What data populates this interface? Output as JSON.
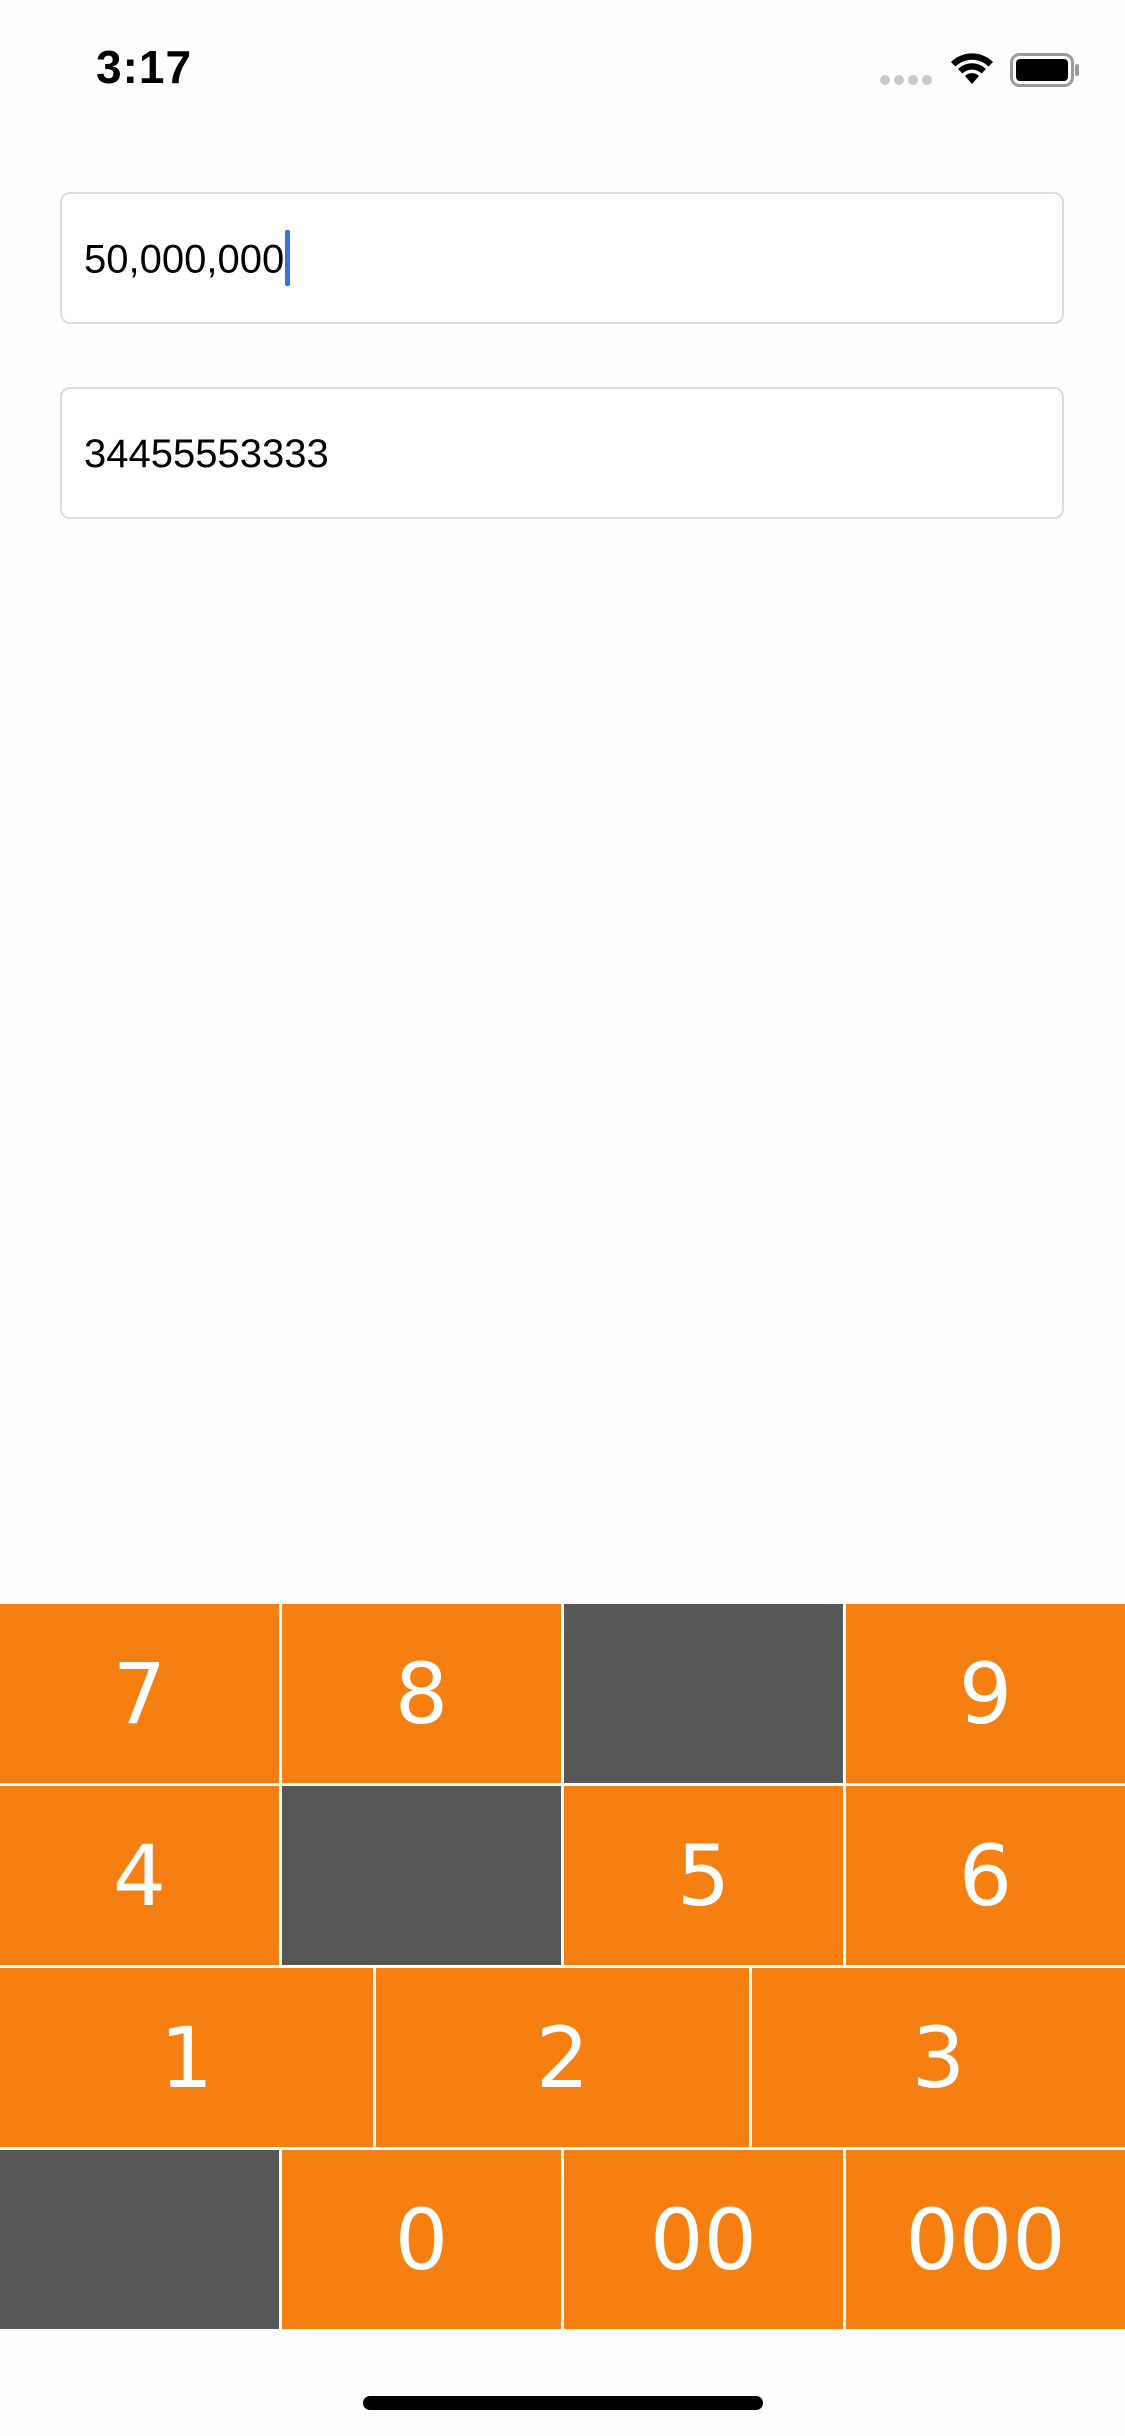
{
  "status_bar": {
    "time": "3:17"
  },
  "fields": {
    "amount_value": "50,000,000",
    "phone_value": "34455553333"
  },
  "keypad": {
    "row1": [
      "7",
      "8",
      "",
      "9"
    ],
    "row2": [
      "4",
      "",
      "5",
      "6"
    ],
    "row3": [
      "1",
      "2",
      "3"
    ],
    "row4": [
      "",
      "0",
      "00",
      "000"
    ]
  },
  "colors": {
    "key_orange": "#f58011",
    "key_blank": "#575757",
    "caret_blue": "#3b6fe0"
  },
  "icons": {
    "signal": "cellular-signal-icon",
    "wifi": "wifi-icon",
    "battery": "battery-icon"
  }
}
